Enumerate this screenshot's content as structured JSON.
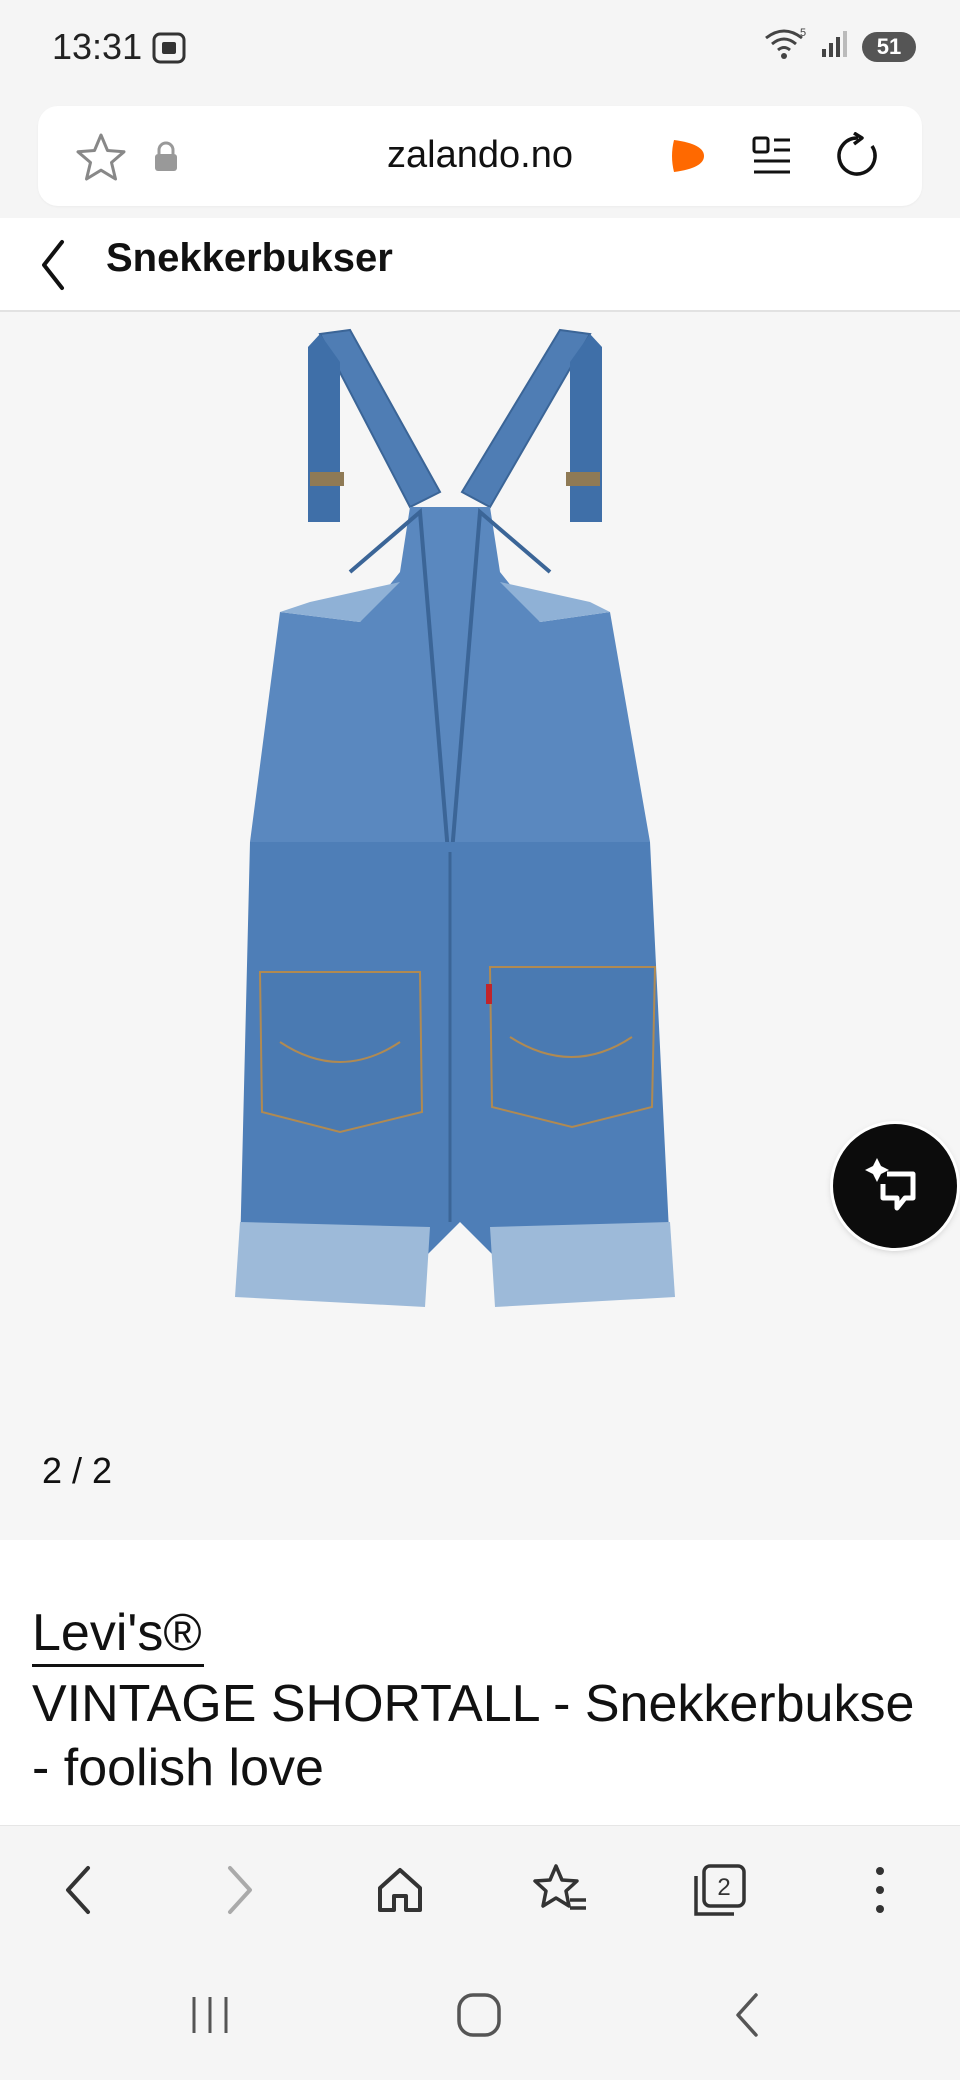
{
  "status_bar": {
    "time": "13:31",
    "battery": "51",
    "wifi_badge": "5"
  },
  "address_bar": {
    "url": "zalando.no"
  },
  "header": {
    "title": "Snekkerbukser"
  },
  "gallery": {
    "counter": "2 / 2"
  },
  "product": {
    "brand": "Levi's®",
    "name": "VINTAGE SHORTALL - Snekkerbukse - foolish love"
  },
  "colors": {
    "accent": "#ff6900",
    "denim": "#4a78b0",
    "black": "#0c0c0c"
  },
  "icons": {
    "toolbar": [
      "back-icon",
      "forward-icon",
      "home-icon",
      "bookmarks-icon",
      "tabs-icon",
      "more-icon"
    ],
    "tabs_count": "2"
  }
}
